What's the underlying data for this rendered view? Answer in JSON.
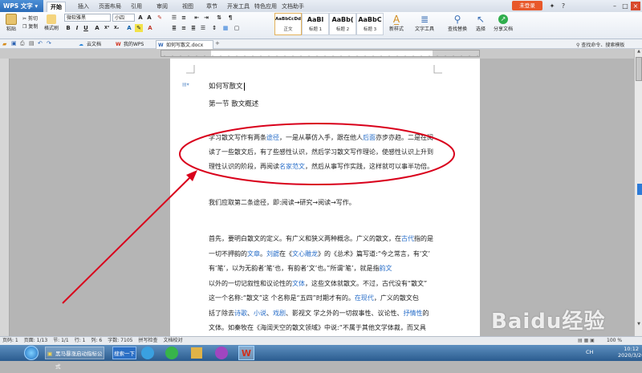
{
  "titlebar": {
    "app": "WPS 文字",
    "menu": [
      "开始",
      "插入",
      "页面布局",
      "引用",
      "审阅",
      "视图",
      "章节",
      "开发工具",
      "特色应用",
      "文档助手"
    ],
    "login": "未登录"
  },
  "ribbon": {
    "paste": "粘贴",
    "cut": "剪切",
    "copy": "复制",
    "format_painter": "格式刷",
    "font_name": "微软雅黑",
    "font_size": "小四",
    "styles": [
      {
        "preview": "AaBbCcDd",
        "label": "正文"
      },
      {
        "preview": "AaBl",
        "label": "标题 1"
      },
      {
        "preview": "AaBb(",
        "label": "标题 2"
      },
      {
        "preview": "AaBbC",
        "label": "标题 3"
      }
    ],
    "new_style": "新样式",
    "text_tools": "文字工具",
    "find_replace": "查找替换",
    "select": "选择",
    "share": "分享文档"
  },
  "quickbar": {
    "tabs": [
      "云文档",
      "我的WPS",
      "如何写散文.docx"
    ],
    "search_hint": "查找命令、搜索模板"
  },
  "document": {
    "title": "如何写散文",
    "section": "第一节  散文概述",
    "p1": [
      [
        {
          "t": "学习散文写作有两条"
        },
        {
          "t": "途径",
          "link": true
        },
        {
          "t": "，一是从摹仿入手，跟在他人"
        },
        {
          "t": "后面",
          "link": true
        },
        {
          "t": "亦步亦趋。二是在阅"
        }
      ],
      [
        {
          "t": "读了一些散文后，有了些感性认识，然后学习散文写作理论，使感性认识上升到"
        }
      ],
      [
        {
          "t": "理性认识的阶段，再阅读"
        },
        {
          "t": "名家范文",
          "link": true
        },
        {
          "t": "，然后从事写作实践，这样就可以事半功倍。"
        }
      ]
    ],
    "p2": "我们应取第二条途径，即:阅读→研究→阅读→写作。",
    "p3": [
      [
        {
          "t": "首先，要明白散文的定义。有广义和狭义两种概念。广义的散文，在"
        },
        {
          "t": "古代",
          "link": true
        },
        {
          "t": "指的是"
        }
      ],
      [
        {
          "t": "一切不押韵的"
        },
        {
          "t": "文章",
          "link": true
        },
        {
          "t": "。"
        },
        {
          "t": "刘勰",
          "link": true
        },
        {
          "t": "在《"
        },
        {
          "t": "文心雕龙",
          "link": true
        },
        {
          "t": "》的《总术》篇写道:“今之常言，有‘文’"
        }
      ],
      [
        {
          "t": "有‘笔’，以为无韵者‘笔’也，有韵者‘文’也。”所谓‘笔’，就是指"
        },
        {
          "t": "韵文",
          "link": true
        }
      ],
      [
        {
          "t": "以外的一切记叙性和议论性的"
        },
        {
          "t": "文体",
          "link": true
        },
        {
          "t": "，这些文体就散文。不过，古代没有“散文”"
        }
      ],
      [
        {
          "t": "这一个名称:“散文”这 个名称是“五四”时期才有的。"
        },
        {
          "t": "在现代",
          "link": true
        },
        {
          "t": "，广义的散文包"
        }
      ],
      [
        {
          "t": "括了除去"
        },
        {
          "t": "诗歌",
          "link": true
        },
        {
          "t": "、"
        },
        {
          "t": "小说",
          "link": true
        },
        {
          "t": "、"
        },
        {
          "t": "戏剧",
          "link": true
        },
        {
          "t": "、影视文 学之外的一切叙事性、议论性、"
        },
        {
          "t": "抒情性",
          "link": true
        },
        {
          "t": "的"
        }
      ],
      [
        {
          "t": "文体。如秦牧在《海阔天空的散文领域》中说:“不属于其他文学体裁，而又具"
        }
      ]
    ]
  },
  "statusbar": {
    "items": [
      "页码: 1",
      "页面: 1/13",
      "节: 1/1",
      "行: 1",
      "列: 6",
      "字数: 7105",
      "拼写检查",
      "文档校对"
    ],
    "zoom": "100 %"
  },
  "taskbar": {
    "items": [
      "黑马暴涨启动指标公式",
      "搜索一下"
    ],
    "lang": "CH",
    "time": "10:12",
    "date": "2020/3/20"
  },
  "watermark": "Baidu经验",
  "accent": "#d9001b"
}
